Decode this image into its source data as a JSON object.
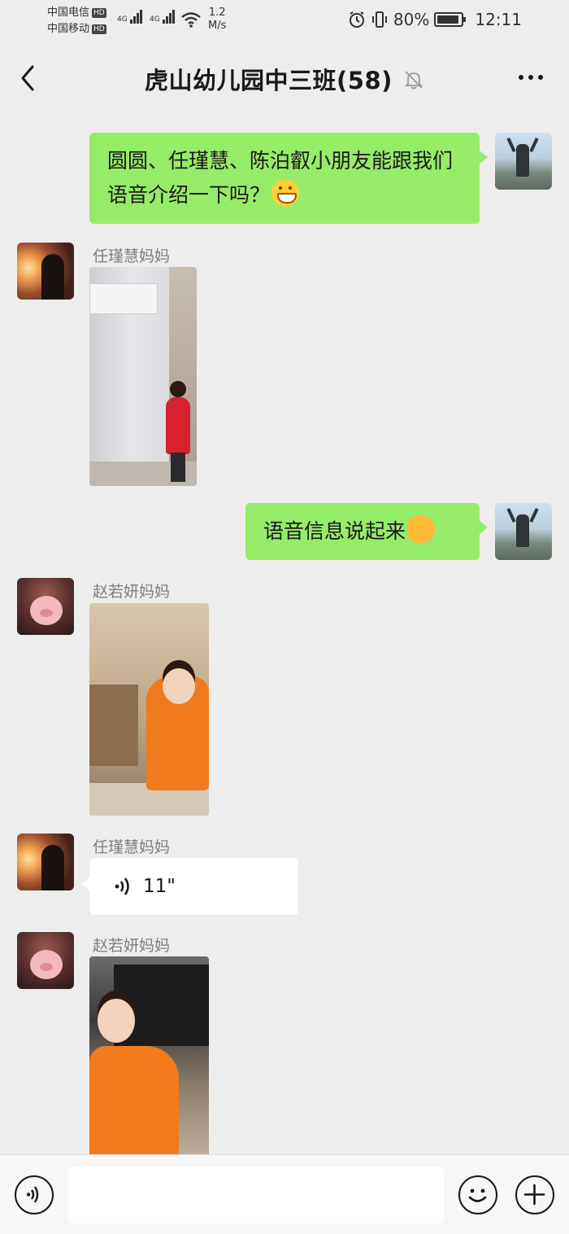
{
  "status_bar": {
    "carrier1": "中国电信",
    "carrier2": "中国移动",
    "hd": "HD",
    "network": "4G",
    "speed_value": "1.2",
    "speed_unit": "M/s",
    "battery_percent": "80%",
    "time": "12:11"
  },
  "header": {
    "title": "虎山幼儿园中三班(58)"
  },
  "messages": [
    {
      "type": "text",
      "from": "self",
      "text": "圆圆、任瑾慧、陈泊叡小朋友能跟我们语音介绍一下吗？",
      "emoji": "grinning-face"
    },
    {
      "type": "image",
      "from": "other",
      "sender": "任瑾慧妈妈"
    },
    {
      "type": "text",
      "from": "self",
      "text": "语音信息说起来",
      "emoji": "ok-hand"
    },
    {
      "type": "image",
      "from": "other",
      "sender": "赵若妍妈妈"
    },
    {
      "type": "voice",
      "from": "other",
      "sender": "任瑾慧妈妈",
      "duration": "11\""
    },
    {
      "type": "image",
      "from": "other",
      "sender": "赵若妍妈妈"
    }
  ],
  "colors": {
    "background": "#ededed",
    "self_bubble": "#95ec69",
    "other_bubble": "#ffffff",
    "sender_name": "#7f7f7f"
  }
}
